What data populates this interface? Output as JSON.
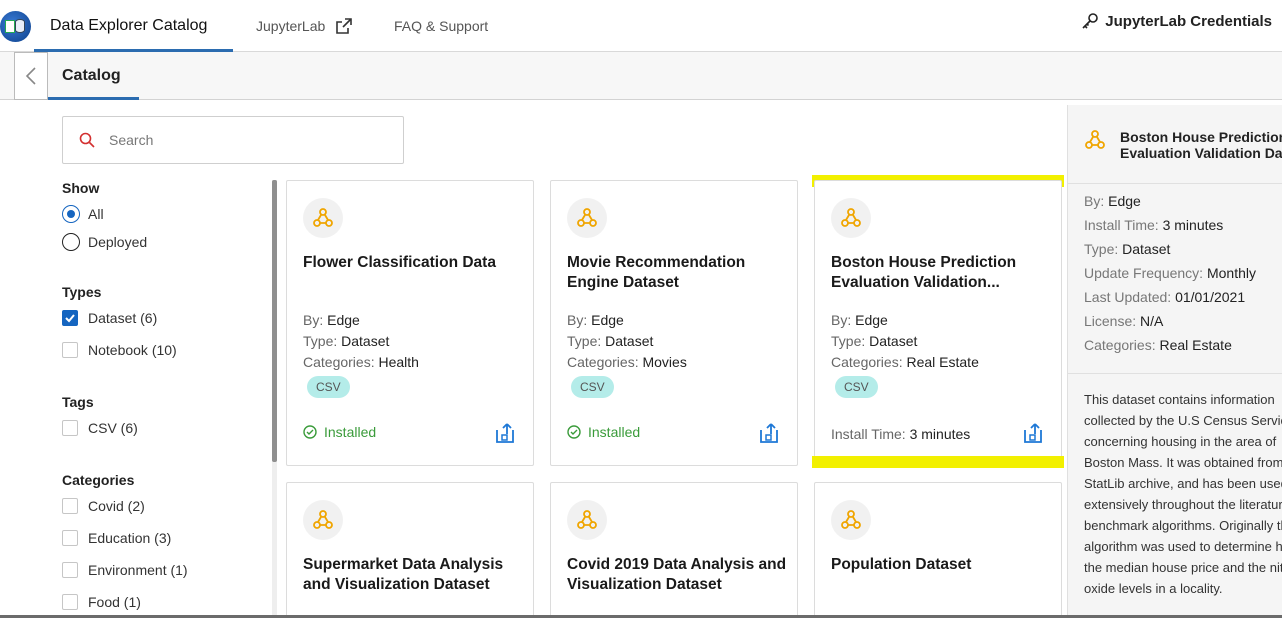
{
  "topnav": {
    "tabs": [
      "Data Explorer Catalog",
      "JupyterLab",
      "FAQ & Support"
    ],
    "credentials": "JupyterLab Credentials"
  },
  "subnav": {
    "tab": "Catalog"
  },
  "search": {
    "placeholder": "Search"
  },
  "filters": {
    "show_heading": "Show",
    "show_options": [
      "All",
      "Deployed"
    ],
    "types_heading": "Types",
    "types": [
      "Dataset (6)",
      "Notebook (10)"
    ],
    "tags_heading": "Tags",
    "tags": [
      "CSV (6)"
    ],
    "categories_heading": "Categories",
    "categories": [
      "Covid (2)",
      "Education (3)",
      "Environment (1)",
      "Food (1)"
    ]
  },
  "card_labels": {
    "by": "By:",
    "type": "Type:",
    "categories": "Categories:",
    "install_time": "Install Time:"
  },
  "cards": [
    {
      "title": "Flower Classification Data",
      "by": "Edge",
      "type": "Dataset",
      "category": "Health",
      "tag": "CSV",
      "status": "Installed"
    },
    {
      "title": "Movie Recommendation Engine Dataset",
      "by": "Edge",
      "type": "Dataset",
      "category": "Movies",
      "tag": "CSV",
      "status": "Installed"
    },
    {
      "title": "Boston House Prediction Evaluation Validation...",
      "by": "Edge",
      "type": "Dataset",
      "category": "Real Estate",
      "tag": "CSV",
      "install_time": "3 minutes"
    },
    {
      "title": "Supermarket Data Analysis and Visualization Dataset"
    },
    {
      "title": "Covid 2019 Data Analysis and Visualization Dataset"
    },
    {
      "title": "Population Dataset"
    }
  ],
  "detail": {
    "title_line1": "Boston House Prediction",
    "title_line2": "Evaluation Validation Dataset",
    "meta": [
      {
        "label": "By:",
        "value": "Edge"
      },
      {
        "label": "Install Time:",
        "value": "3 minutes"
      },
      {
        "label": "Type:",
        "value": "Dataset"
      },
      {
        "label": "Update Frequency:",
        "value": "Monthly"
      },
      {
        "label": "Last Updated:",
        "value": "01/01/2021"
      },
      {
        "label": "License:",
        "value": "N/A"
      },
      {
        "label": "Categories:",
        "value": "Real Estate"
      }
    ],
    "description": "This dataset contains information\ncollected by the U.S Census Service\nconcerning housing in the area of\nBoston Mass. It was obtained from the\nStatLib archive, and has been used\nextensively throughout the literature to\nbenchmark algorithms. Originally this\nalgorithm was used to determine how\nthe median house price and the nitric\noxide levels in a locality."
  },
  "colors": {
    "accent": "#1565c0",
    "highlight": "#f2f000",
    "installed": "#3a9b3a",
    "tag": "#b4ece9",
    "icon": "#f0a500"
  }
}
